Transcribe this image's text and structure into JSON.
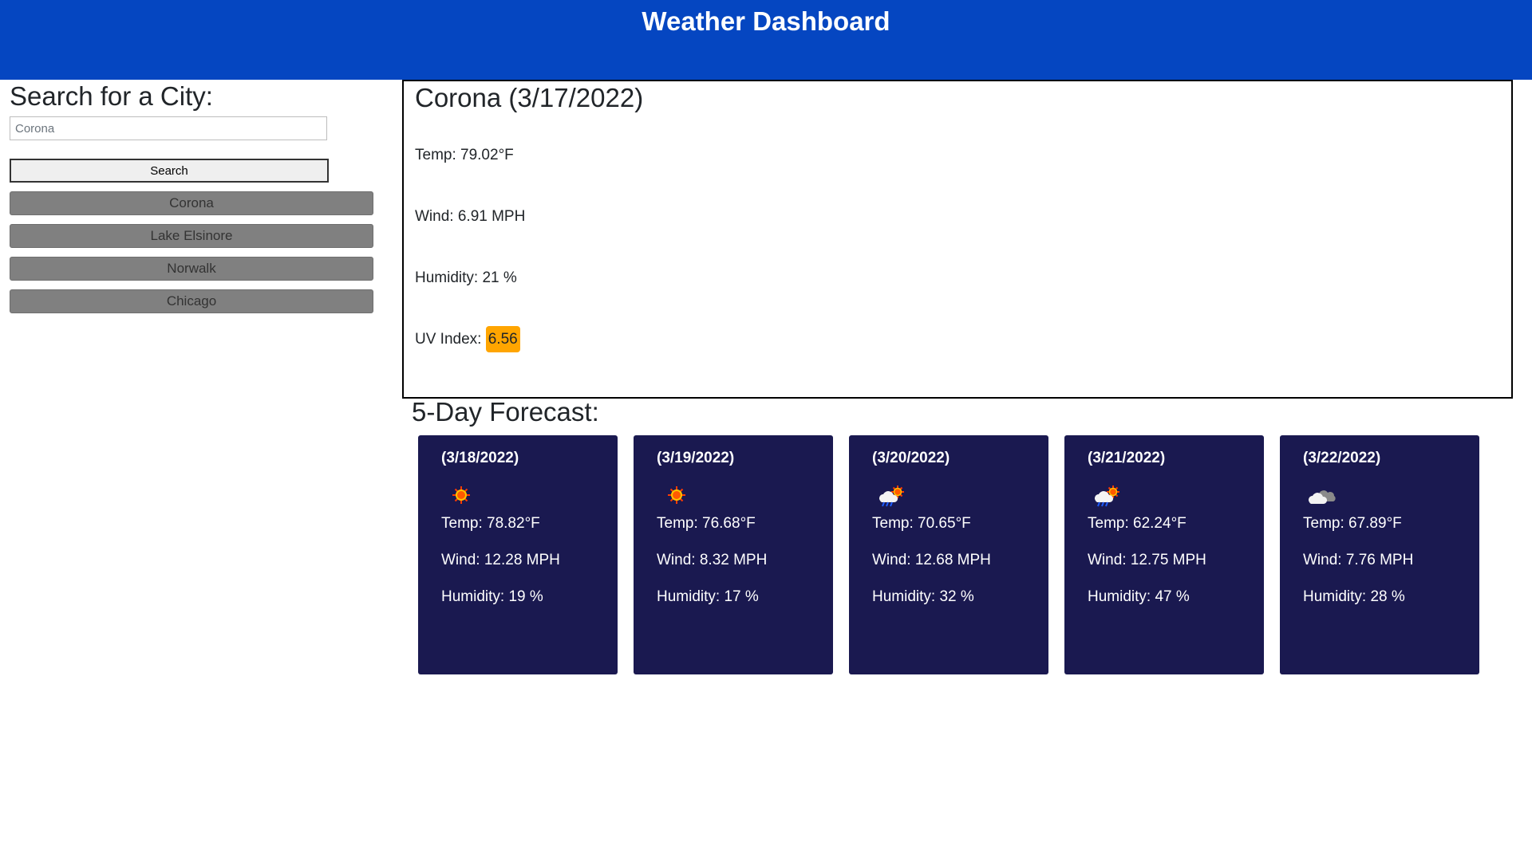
{
  "header": {
    "title": "Weather Dashboard"
  },
  "sidebar": {
    "heading": "Search for a City:",
    "search_value": "Corona",
    "search_button": "Search",
    "history": [
      "Corona",
      "Lake Elsinore",
      "Norwalk",
      "Chicago"
    ]
  },
  "current": {
    "title": "Corona (3/17/2022)",
    "temp": "Temp: 79.02°F",
    "wind": "Wind: 6.91 MPH",
    "humidity": "Humidity: 21 %",
    "uv_label": "UV Index: ",
    "uv_value": "6.56",
    "uv_color": "#ffa500"
  },
  "forecast": {
    "title": "5-Day Forecast:",
    "days": [
      {
        "date": "(3/18/2022)",
        "icon": "sun-icon",
        "temp": "Temp: 78.82°F",
        "wind": "Wind: 12.28 MPH",
        "humidity": "Humidity: 19 %"
      },
      {
        "date": "(3/19/2022)",
        "icon": "sun-icon",
        "temp": "Temp: 76.68°F",
        "wind": "Wind: 8.32 MPH",
        "humidity": "Humidity: 17 %"
      },
      {
        "date": "(3/20/2022)",
        "icon": "sun-rain-cloud-icon",
        "temp": "Temp: 70.65°F",
        "wind": "Wind: 12.68 MPH",
        "humidity": "Humidity: 32 %"
      },
      {
        "date": "(3/21/2022)",
        "icon": "sun-rain-cloud-icon",
        "temp": "Temp: 62.24°F",
        "wind": "Wind: 12.75 MPH",
        "humidity": "Humidity: 47 %"
      },
      {
        "date": "(3/22/2022)",
        "icon": "cloudy-icon",
        "temp": "Temp: 67.89°F",
        "wind": "Wind: 7.76 MPH",
        "humidity": "Humidity: 28 %"
      }
    ]
  },
  "colors": {
    "header": "#0546c1",
    "card": "#1a1950",
    "uv": "#ffa500",
    "history_button": "#808080"
  }
}
